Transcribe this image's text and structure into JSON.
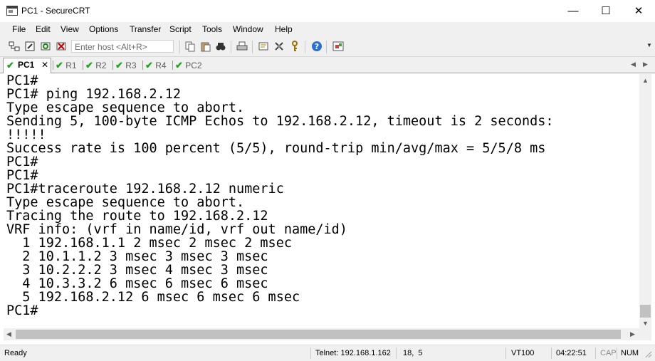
{
  "window": {
    "title": "PC1 - SecureCRT"
  },
  "menu": [
    "File",
    "Edit",
    "View",
    "Options",
    "Transfer",
    "Script",
    "Tools",
    "Window",
    "Help"
  ],
  "toolbar": {
    "host_placeholder": "Enter host <Alt+R>"
  },
  "tabs": [
    {
      "label": "PC1",
      "active": true,
      "status": "connected"
    },
    {
      "label": "R1",
      "active": false,
      "status": "connected"
    },
    {
      "label": "R2",
      "active": false,
      "status": "connected"
    },
    {
      "label": "R3",
      "active": false,
      "status": "connected"
    },
    {
      "label": "R4",
      "active": false,
      "status": "connected"
    },
    {
      "label": "PC2",
      "active": false,
      "status": "connected"
    }
  ],
  "terminal": {
    "lines": [
      "PC1#",
      "PC1# ping 192.168.2.12",
      "Type escape sequence to abort.",
      "Sending 5, 100-byte ICMP Echos to 192.168.2.12, timeout is 2 seconds:",
      "!!!!!",
      "Success rate is 100 percent (5/5), round-trip min/avg/max = 5/5/8 ms",
      "PC1#",
      "PC1#",
      "PC1#traceroute 192.168.2.12 numeric",
      "Type escape sequence to abort.",
      "Tracing the route to 192.168.2.12",
      "VRF info: (vrf in name/id, vrf out name/id)",
      "  1 192.168.1.1 2 msec 2 msec 2 msec",
      "  2 10.1.1.2 3 msec 3 msec 3 msec",
      "  3 10.2.2.2 3 msec 4 msec 3 msec",
      "  4 10.3.3.2 6 msec 6 msec 6 msec",
      "  5 192.168.2.12 6 msec 6 msec 6 msec",
      "PC1#"
    ]
  },
  "status": {
    "ready": "Ready",
    "connection": "Telnet: 192.168.1.162",
    "cursor": "18,  5",
    "emulation": "VT100",
    "time": "04:22:51",
    "caps": "CAP",
    "num": "NUM"
  },
  "colors": {
    "tab_check": "#21a321",
    "chrome": "#f0f0f0"
  }
}
